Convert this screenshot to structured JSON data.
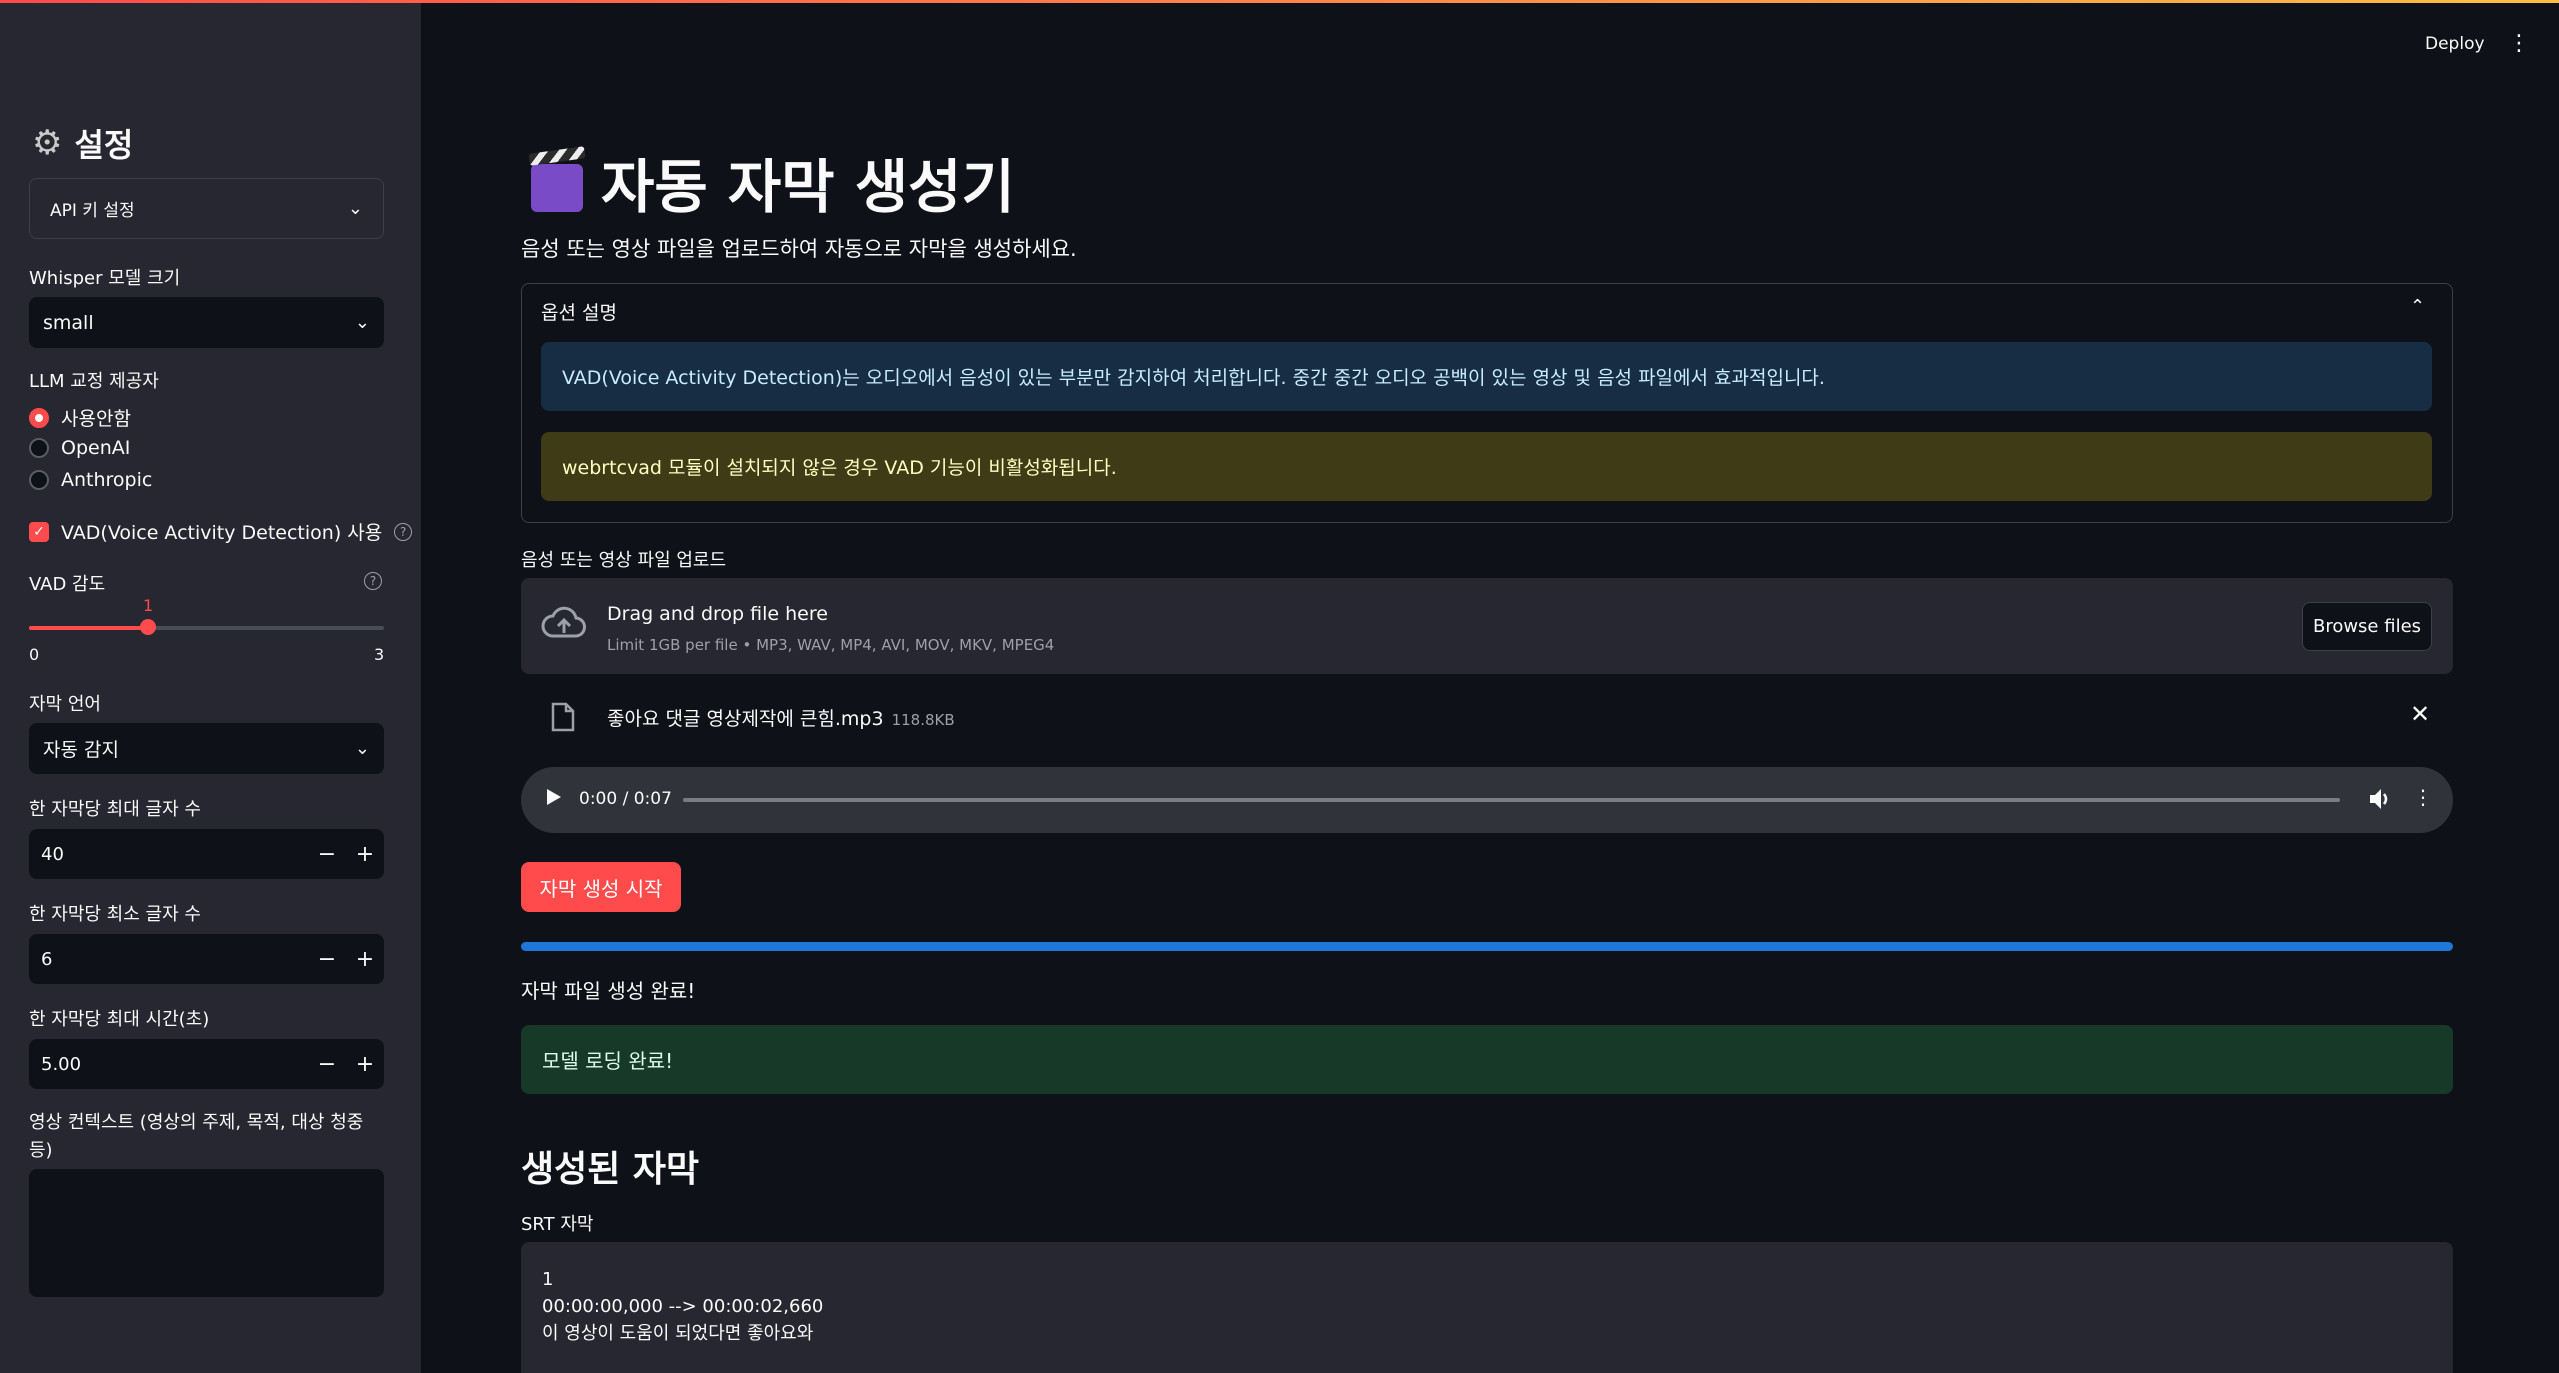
{
  "header": {
    "deploy_label": "Deploy"
  },
  "sidebar": {
    "title": "설정",
    "api_expander": "API 키 설정",
    "whisper": {
      "label": "Whisper 모델 크기",
      "value": "small"
    },
    "llm": {
      "label": "LLM 교정 제공자",
      "options": [
        "사용안함",
        "OpenAI",
        "Anthropic"
      ],
      "selected": "사용안함"
    },
    "vad_checkbox": "VAD(Voice Activity Detection) 사용",
    "vad_sensitivity": {
      "label": "VAD 감도",
      "value": "1",
      "min": "0",
      "max": "3",
      "fraction": 0.333
    },
    "language": {
      "label": "자막 언어",
      "value": "자동 감지"
    },
    "max_chars": {
      "label": "한 자막당 최대 글자 수",
      "value": "40"
    },
    "min_chars": {
      "label": "한 자막당 최소 글자 수",
      "value": "6"
    },
    "max_time": {
      "label": "한 자막당 최대 시간(초)",
      "value": "5.00"
    },
    "context": {
      "label_line1": "영상 컨텍스트 (영상의 주제, 목적, 대상 청중",
      "label_line2": "등)",
      "value": ""
    }
  },
  "main": {
    "title": "자동 자막 생성기",
    "subtitle": "음성 또는 영상 파일을 업로드하여 자동으로 자막을 생성하세요.",
    "options": {
      "header": "옵션 설명",
      "info": "VAD(Voice Activity Detection)는 오디오에서 음성이 있는 부분만 감지하여 처리합니다. 중간 중간 오디오 공백이 있는 영상 및 음성 파일에서 효과적입니다.",
      "warning": "webrtcvad 모듈이 설치되지 않은 경우 VAD 기능이 비활성화됩니다."
    },
    "upload": {
      "label": "음성 또는 영상 파일 업로드",
      "drop_text": "Drag and drop file here",
      "limit_text": "Limit 1GB per file • MP3, WAV, MP4, AVI, MOV, MKV, MPEG4",
      "browse_label": "Browse files",
      "file_name": "좋아요 댓글 영상제작에 큰힘.mp3",
      "file_size": "118.8KB"
    },
    "audio": {
      "time": "0:00 / 0:07"
    },
    "start_button": "자막 생성 시작",
    "progress": 1.0,
    "status_text": "자막 파일 생성 완료!",
    "success_text": "모델 로딩 완료!",
    "result_title": "생성된 자막",
    "srt_label": "SRT 자막",
    "srt_lines": [
      "1",
      "00:00:00,000 --> 00:00:02,660",
      "이 영상이 도움이 되었다면 좋아요와"
    ]
  }
}
